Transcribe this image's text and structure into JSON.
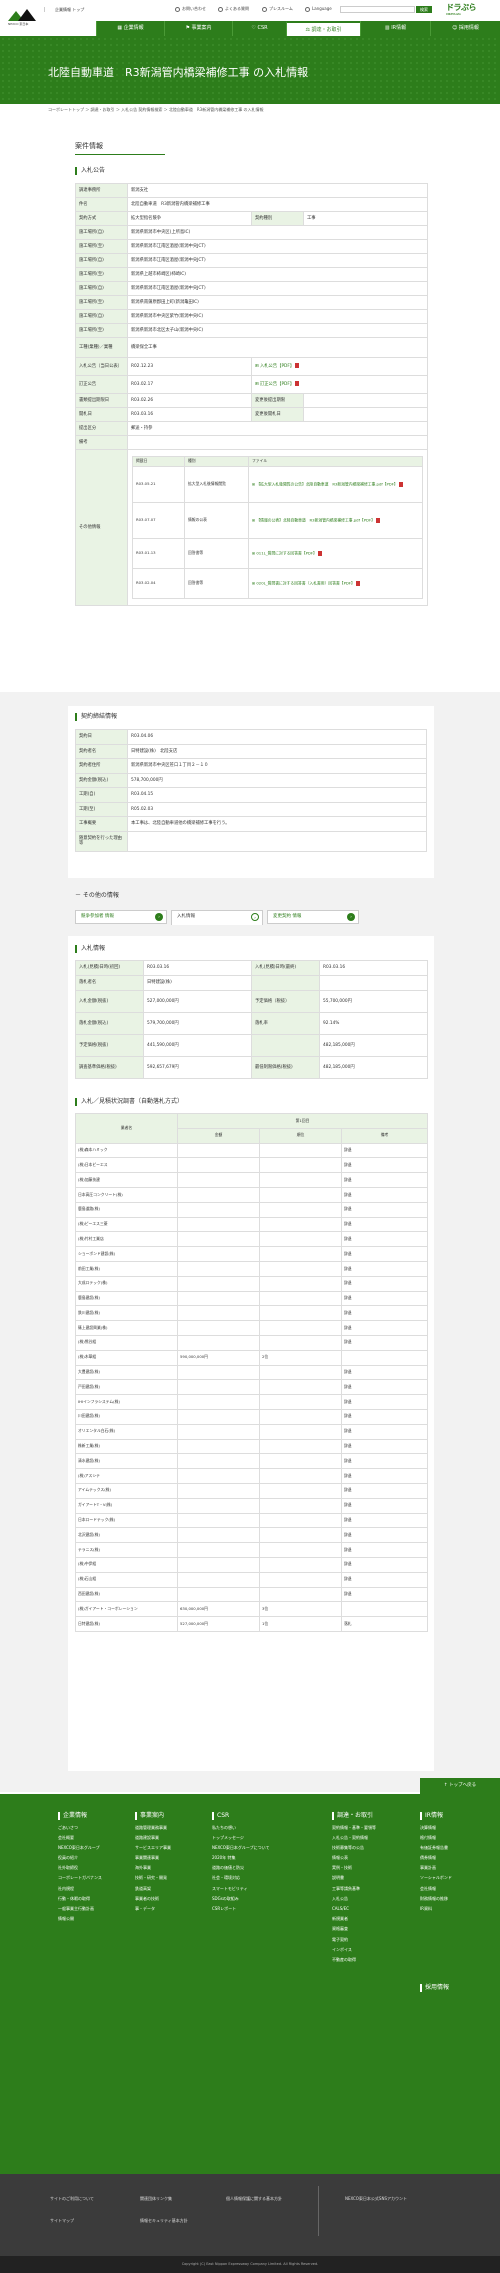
{
  "header": {
    "logo_text": "NEXCO 東日本",
    "corporate_label": "企業情報 トップ",
    "util_links": [
      "お問い合わせ",
      "よくある質問",
      "プレスルーム",
      "Language"
    ],
    "search_placeholder": "",
    "search_button": "検索",
    "drapla_logo": "ドラぷら",
    "drapla_sub": "DRIVE PLAZA"
  },
  "gnav": [
    "企業情報",
    "事業案内",
    "CSR",
    "調達・お取引",
    "IR情報",
    "採用情報"
  ],
  "gnav_active": 3,
  "page_title": "北陸自動車道　R3新潟管内橋梁補修工事 の入札情報",
  "breadcrumb": "コーポレートトップ ＞ 調達・お取引 ＞ 入札公告 契約情報検索 ＞ 北陸自動車道　R3新潟管内橋梁補修工事 の入札情報",
  "section_title": "案件情報",
  "notice": {
    "heading": "入札公告",
    "rows": [
      {
        "k": "調達事務所",
        "v": "新潟支社"
      },
      {
        "k": "件名",
        "v": "北陸自動車道　R3新潟管内橋梁補修工事"
      },
      {
        "k": "契約方式",
        "v": "拡大型指名競争",
        "k2": "契約種別",
        "v2": "工事"
      },
      {
        "k": "施工場所(自)",
        "v": "新潟県新潟市中央区(上所島IC)"
      },
      {
        "k": "施工場所(至)",
        "v": "新潟県新潟市江南区酒屋(新潟中央JCT)"
      },
      {
        "k": "施工場所(自)",
        "v": "新潟県新潟市江南区酒屋(新潟中央JCT)"
      },
      {
        "k": "施工場所(至)",
        "v": "新潟県上越市柿崎区(柿崎IC)"
      },
      {
        "k": "施工場所(自)",
        "v": "新潟県新潟市江南区酒屋(新潟中央JCT)"
      },
      {
        "k": "施工場所(至)",
        "v": "新潟県南蒲原郡田上町(新潟亀田IC)"
      },
      {
        "k": "施工場所(自)",
        "v": "新潟県新潟市中央区紫竹(新潟中央IC)"
      },
      {
        "k": "施工場所(至)",
        "v": "新潟県新潟市北区太子山(新潟中央IC)"
      },
      {
        "k": "工種(業種)／業種",
        "v": "橋梁保全工事"
      }
    ],
    "date1_label": "入札公告（当日公表）",
    "date1": "R02.12.23",
    "date1_file": "入札公告【PDF】",
    "date2_label": "訂正公告",
    "date2": "R03.02.17",
    "date2_file": "訂正公告【PDF】",
    "rows2": [
      {
        "k": "書類提出期限日",
        "v": "R03.02.26",
        "k2": "変更後提出期限",
        "v2": ""
      },
      {
        "k": "開札日",
        "v": "R03.03.16",
        "k2": "変更後開札日",
        "v2": ""
      },
      {
        "k": "提出区分",
        "v": "郵送・持参",
        "k2": "",
        "v2": ""
      },
      {
        "k": "備考",
        "v": "",
        "k2": "",
        "v2": ""
      }
    ],
    "other_label": "その他情報",
    "other_headers": [
      "掲載日",
      "種別",
      "ファイル"
    ],
    "other_rows": [
      {
        "date": "R03.05.21",
        "type": "拡大型入札後情報閲覧",
        "file": "【拡大型入札後閲覧の公告】北陸自動車道　R3新潟管内橋梁補修工事.pdf【PDF】"
      },
      {
        "date": "R03.07.07",
        "type": "情報の公表",
        "file": "【情報の公表】北陸自動車道　R3新潟管内橋梁補修工事.pdf【PDF】"
      },
      {
        "date": "R03.01.13",
        "type": "回答書等",
        "file": "011L_質問に対する回答書【PDF】"
      },
      {
        "date": "R03.02.04",
        "type": "回答書等",
        "file": "020L_質問書に対する回答書（入札書用）回答書【PDF】"
      }
    ]
  },
  "contract": {
    "heading": "契約締結情報",
    "rows": [
      {
        "k": "契約日",
        "v": "R03.04.06"
      },
      {
        "k": "契約者名",
        "v": "日特建設(株)　北陸支店"
      },
      {
        "k": "契約者住所",
        "v": "新潟県新潟市中央区笹口１丁目２－１０"
      },
      {
        "k": "契約金額(税込)",
        "v": "578,700,000円"
      },
      {
        "k": "工期(自)",
        "v": "R03.04.15"
      },
      {
        "k": "工期(至)",
        "v": "R05.02.03"
      },
      {
        "k": "工事概要",
        "v": "本工事は、北陸自動車道他の橋梁補修工事を行う。"
      },
      {
        "k": "随意契約を行った理由等",
        "v": ""
      }
    ]
  },
  "other_info": {
    "heading": "その他の情報",
    "tabs": [
      "競争参加者 情報",
      "入札情報",
      "変更契約 情報"
    ],
    "active": 1
  },
  "bid": {
    "heading": "入札情報",
    "rows": [
      {
        "k": "入札(見積)日時(初回)",
        "v": "R03.03.16",
        "k2": "入札(見積)日時(最終)",
        "v2": "R03.03.16"
      },
      {
        "k": "落札者名",
        "v": "日特建設(株)",
        "k2": "",
        "v2": ""
      },
      {
        "k": "入札金額(税抜)",
        "v": "527,000,000円",
        "k2": "予定価格（税抜）",
        "v2": "55,700,000円"
      },
      {
        "k": "落札金額(税込)",
        "v": "579,700,000円",
        "k2": "落札率",
        "v2": "92.14%"
      },
      {
        "k": "予定価格(税抜)",
        "v": "441,590,000円",
        "k2": "",
        "v2": "482,185,000円"
      },
      {
        "k": "調査基準価格(税抜)",
        "v": "592,657,679円",
        "k2": "最低制限価格(税抜)",
        "v2": "482,185,000円"
      }
    ]
  },
  "results": {
    "heading": "入札／見積状況調書（自動落札方式）",
    "col_company": "業者名",
    "col_round": "第1回目",
    "sub_cols": [
      "金額",
      "順位",
      "備考"
    ],
    "rows": [
      {
        "name": "(株)森本ハミック",
        "amount": "",
        "rank": "",
        "note": "辞退"
      },
      {
        "name": "(株)日本ピーエス",
        "amount": "",
        "rank": "",
        "note": "辞退"
      },
      {
        "name": "(株)加藤技建",
        "amount": "",
        "rank": "",
        "note": "辞退"
      },
      {
        "name": "日本高圧コンクリート(株)",
        "amount": "",
        "rank": "",
        "note": "辞退"
      },
      {
        "name": "鹿島道路(株)",
        "amount": "",
        "rank": "",
        "note": "辞退"
      },
      {
        "name": "(株)ピーエス三菱",
        "amount": "",
        "rank": "",
        "note": "辞退"
      },
      {
        "name": "(株)竹村工業店",
        "amount": "",
        "rank": "",
        "note": "辞退"
      },
      {
        "name": "ショーボンド建設(株)",
        "amount": "",
        "rank": "",
        "note": "辞退"
      },
      {
        "name": "前田工業(株)",
        "amount": "",
        "rank": "",
        "note": "辞退"
      },
      {
        "name": "大成ロテック(株)",
        "amount": "",
        "rank": "",
        "note": "辞退"
      },
      {
        "name": "鹿島建設(株)",
        "amount": "",
        "rank": "",
        "note": "辞退"
      },
      {
        "name": "鉄川建設(株)",
        "amount": "",
        "rank": "",
        "note": "辞退"
      },
      {
        "name": "篠上建設興業(株)",
        "amount": "",
        "rank": "",
        "note": "辞退"
      },
      {
        "name": "(株)熊谷組",
        "amount": "",
        "rank": "",
        "note": "辞退"
      },
      {
        "name": "(株)木華組",
        "amount": "590,000,000円",
        "rank": "2位",
        "note": ""
      },
      {
        "name": "大豊建設(株)",
        "amount": "",
        "rank": "",
        "note": "辞退"
      },
      {
        "name": "戸田建設(株)",
        "amount": "",
        "rank": "",
        "note": "辞退"
      },
      {
        "name": "IHIインフラシステム(株)",
        "amount": "",
        "rank": "",
        "note": "辞退"
      },
      {
        "name": "川田建設(株)",
        "amount": "",
        "rank": "",
        "note": "辞退"
      },
      {
        "name": "オリエンタル白石(株)",
        "amount": "",
        "rank": "",
        "note": "辞退"
      },
      {
        "name": "株新工業(株)",
        "amount": "",
        "rank": "",
        "note": "辞退"
      },
      {
        "name": "清水建設(株)",
        "amount": "",
        "rank": "",
        "note": "辞退"
      },
      {
        "name": "(株)アスシテ",
        "amount": "",
        "rank": "",
        "note": "辞退"
      },
      {
        "name": "アイムテックス(株)",
        "amount": "",
        "rank": "",
        "note": "辞退"
      },
      {
        "name": "ガイアートT・V(株)",
        "amount": "",
        "rank": "",
        "note": "辞退"
      },
      {
        "name": "日本ロードテック(株)",
        "amount": "",
        "rank": "",
        "note": "辞退"
      },
      {
        "name": "北沢建設(株)",
        "amount": "",
        "rank": "",
        "note": "辞退"
      },
      {
        "name": "テラニス(株)",
        "amount": "",
        "rank": "",
        "note": "辞退"
      },
      {
        "name": "(株)中伊組",
        "amount": "",
        "rank": "",
        "note": "辞退"
      },
      {
        "name": "(株)石山組",
        "amount": "",
        "rank": "",
        "note": "辞退"
      },
      {
        "name": "西田建設(株)",
        "amount": "",
        "rank": "",
        "note": "辞退"
      },
      {
        "name": "(株)ガイアート・コーポレーション",
        "amount": "630,000,000円",
        "rank": "3位",
        "note": ""
      },
      {
        "name": "日特建設(株)",
        "amount": "527,000,000円",
        "rank": "1位",
        "note": "落札"
      }
    ]
  },
  "to_top": "トップへ戻る",
  "footer": {
    "cols": [
      {
        "title": "企業情報",
        "items": [
          "ごあいさつ",
          "会社概要",
          "NEXCO東日本グループ",
          "役員の紹介",
          "社外取締役",
          "コーポレートガバナンス",
          "社内規程",
          "行動・休暇の取得",
          "一般事業主行動計画",
          "情報公開"
        ]
      },
      {
        "title": "事業案内",
        "items": [
          "道路管理業務事業",
          "道路建設事業",
          "サービスエリア事業",
          "事業関連事業",
          "海外事業",
          "技術・研究・開発",
          "鉄道高架",
          "事業者の技術",
          "事・データ"
        ]
      },
      {
        "title": "CSR",
        "items": [
          "私たちの想い",
          "トップメッセージ",
          "NEXCO東日本グループについて",
          "2020年 特集",
          "道路の価値と防災",
          "社会・環境対応",
          "スマートモビリティ",
          "SDGsの取組み",
          "CSRレポート"
        ]
      },
      {
        "title": "調達・お取引",
        "items": [
          "契約情報・基準・要領等",
          "入札公告・契約情報",
          "技術募集等の公告",
          "情報公表",
          "実例・技術",
          "説明書",
          "工事等請負基準",
          "入札公告",
          "CALS/EC",
          "新規業者",
          "資格審査",
          "電子契約",
          "インボイス",
          "不動産の取得"
        ]
      },
      {
        "title": "IR情報",
        "items": [
          "決算情報",
          "格付情報",
          "有価証券報告書",
          "債券情報",
          "事業計画",
          "ソーシャルボンド",
          "会社情報",
          "財務情報の推移",
          "IR資料"
        ]
      },
      {
        "title": "採用情報",
        "items": []
      }
    ],
    "links": [
      "サイトのご利用について",
      "関連団体リンク集",
      "個人情報保護に関する基本方針",
      "サイトマップ",
      "情報セキュリティ基本方針"
    ],
    "nexco_link": "NEXCO東日本公式SNSアカウント",
    "copyright": "Copyright (C) East Nippon Expressway Company Limited. All Rights Reserved."
  }
}
